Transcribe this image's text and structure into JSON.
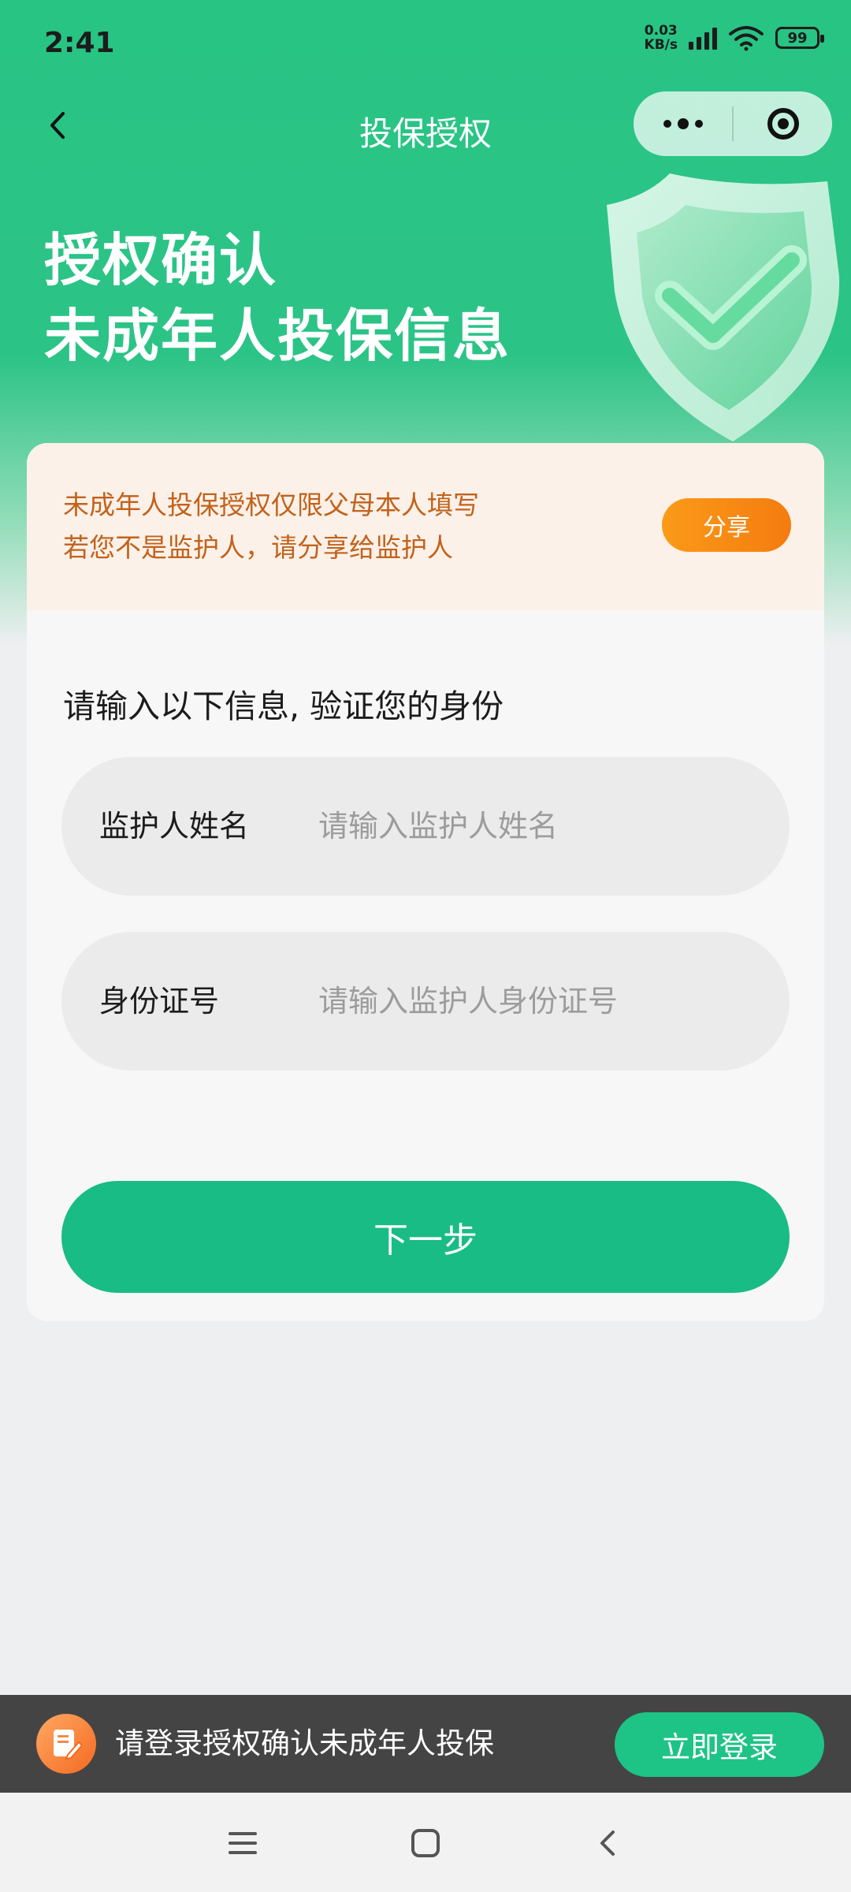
{
  "status_bar": {
    "time": "2:41",
    "net_speed_value": "0.03",
    "net_speed_unit": "KB/s",
    "battery": "99",
    "icons": [
      "signal-icon",
      "wifi-icon",
      "battery-icon"
    ]
  },
  "nav": {
    "title": "投保授权",
    "back_icon": "chevron-left-icon",
    "more_icon": "more-dots-icon",
    "close_icon": "target-close-icon"
  },
  "hero": {
    "title_line1": "授权确认",
    "title_line2": "未成年人投保信息",
    "illustration": "shield-check-icon"
  },
  "notice": {
    "line1": "未成年人投保授权仅限父母本人填写",
    "line2": "若您不是监护人，请分享给监护人",
    "share_label": "分享"
  },
  "form": {
    "heading": "请输入以下信息, 验证您的身份",
    "guardian_name_label": "监护人姓名",
    "guardian_name_placeholder": "请输入监护人姓名",
    "id_label": "身份证号",
    "id_placeholder": "请输入监护人身份证号",
    "next_label": "下一步"
  },
  "login_bar": {
    "text": "请登录授权确认未成年人投保",
    "button_label": "立即登录",
    "icon": "document-edit-icon"
  },
  "system_nav": {
    "icons": [
      "menu-icon",
      "home-square-icon",
      "back-icon"
    ]
  },
  "colors": {
    "brand_green": "#19bc84",
    "header_green": "#28c484",
    "notice_text": "#c2621c",
    "share_orange": "#f7891a"
  }
}
